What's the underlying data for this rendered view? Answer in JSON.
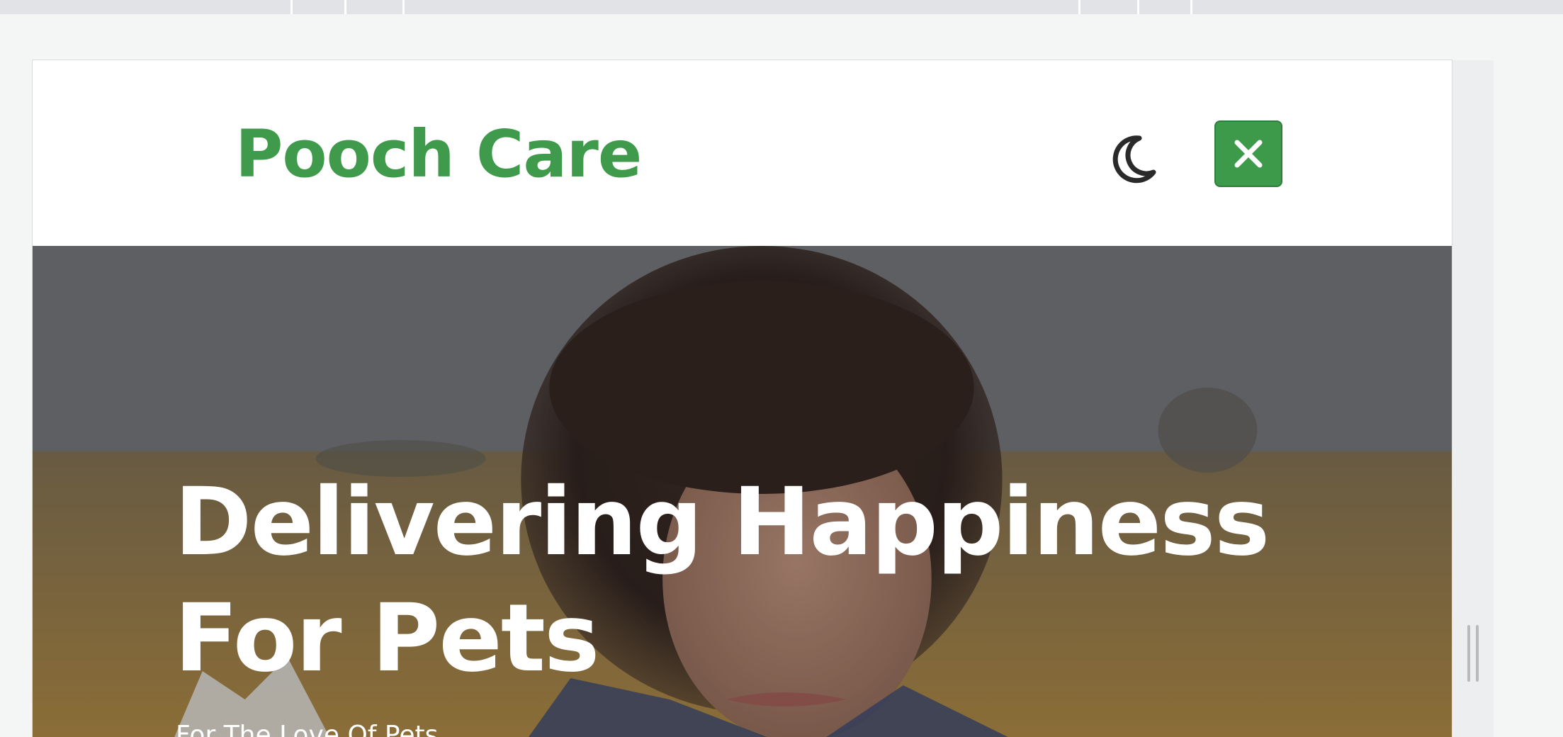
{
  "header": {
    "brand": "Pooch Care"
  },
  "icons": {
    "theme_toggle": "moon-icon",
    "close": "close-icon"
  },
  "hero": {
    "title": "Delivering Happiness For Pets",
    "subtitle": "For The Love Of Pets"
  },
  "colors": {
    "brand_green": "#3f9a4c",
    "button_green": "#3e9a4b",
    "moon_icon": "#2a2a2a"
  }
}
